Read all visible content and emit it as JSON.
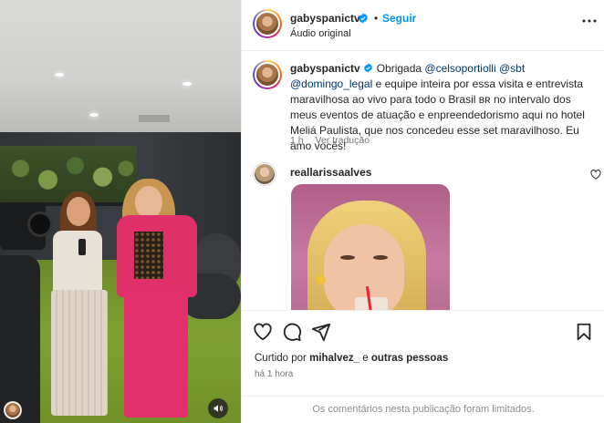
{
  "post": {
    "author": "gabyspanictv",
    "verified": true,
    "separator": "•",
    "follow_label": "Seguir",
    "audio_label": "Áudio original"
  },
  "caption": {
    "author": "gabyspanictv",
    "text_1": "Obrigada ",
    "mention_1": "@celsoportiolli",
    "text_2": " ",
    "mention_2": "@sbt",
    "text_3": " ",
    "mention_3": "@domingo_legal",
    "text_4": " e equipe inteira por essa visita e entrevista maravilhosa ao vivo para todo o Brasil ʙʀ no intervalo dos meus eventos de atuação e enpreendedorismo aqui no hotel Meliá Paulista, que nos concedeu esse set maravilhoso. Eu amo vocês!",
    "time": "1 h",
    "translate_label": "Ver tradução"
  },
  "comment": {
    "author": "reallarissaalves"
  },
  "actions": {
    "liked_prefix": "Curtido por ",
    "liked_user": "mihalvez_",
    "liked_connector": " e ",
    "liked_others": "outras pessoas",
    "time_ago": "há 1 hora",
    "comments_limited": "Os comentários nesta publicação foram limitados."
  },
  "icons": {
    "like": "heart-icon",
    "comment": "comment-icon",
    "share": "share-icon",
    "save": "bookmark-icon",
    "mute": "speaker-icon",
    "more": "more-options-icon",
    "verified": "verified-badge-icon"
  },
  "colors": {
    "accent": "#0095f6",
    "mention": "#00376b",
    "muted_text": "#737373",
    "verified": "#0095f6"
  }
}
